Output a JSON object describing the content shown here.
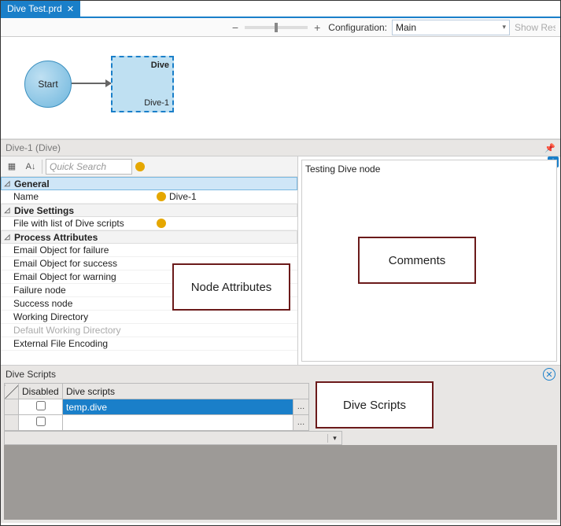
{
  "tab": {
    "title": "Dive Test.prd"
  },
  "toolbar": {
    "config_label": "Configuration:",
    "config_value": "Main",
    "show_result": "Show Resul"
  },
  "canvas": {
    "start_label": "Start",
    "dive_title": "Dive",
    "dive_sub": "Dive-1"
  },
  "status": {
    "text": "Dive-1 (Dive)"
  },
  "props": {
    "search_placeholder": "Quick Search",
    "groups": {
      "general": {
        "header": "General",
        "name_label": "Name",
        "name_value": "Dive-1"
      },
      "dive_settings": {
        "header": "Dive Settings",
        "file_label": "File with list of Dive scripts"
      },
      "process": {
        "header": "Process Attributes",
        "email_fail": "Email Object for failure",
        "email_success": "Email Object for success",
        "email_warn": "Email Object for warning",
        "failure_node": "Failure node",
        "success_node": "Success node",
        "working_dir": "Working Directory",
        "default_wd": "Default Working Directory",
        "ext_enc": "External File Encoding"
      }
    }
  },
  "comments": {
    "text": "Testing Dive node"
  },
  "scripts": {
    "title": "Dive Scripts",
    "cols": {
      "disabled": "Disabled",
      "scripts": "Dive scripts"
    },
    "rows": [
      {
        "disabled": false,
        "value": "temp.dive",
        "selected": true
      },
      {
        "disabled": false,
        "value": "",
        "selected": false
      }
    ]
  },
  "annotations": {
    "node_attrs": "Node Attributes",
    "comments": "Comments",
    "dive_scripts": "Dive Scripts"
  }
}
